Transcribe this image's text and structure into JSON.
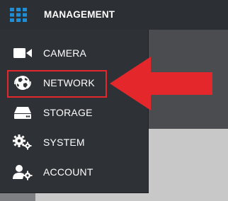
{
  "header": {
    "title": "MANAGEMENT",
    "icon": "grid-icon",
    "icon_color": "#1e8fd6"
  },
  "menu": {
    "items": [
      {
        "label": "CAMERA",
        "icon": "video-camera-icon"
      },
      {
        "label": "NETWORK",
        "icon": "network-globe-icon",
        "highlighted": true
      },
      {
        "label": "STORAGE",
        "icon": "hard-drive-icon"
      },
      {
        "label": "SYSTEM",
        "icon": "gears-icon"
      },
      {
        "label": "ACCOUNT",
        "icon": "user-settings-icon"
      }
    ]
  },
  "annotation": {
    "highlight_color": "#e3272b",
    "arrow_color": "#e3272b"
  }
}
